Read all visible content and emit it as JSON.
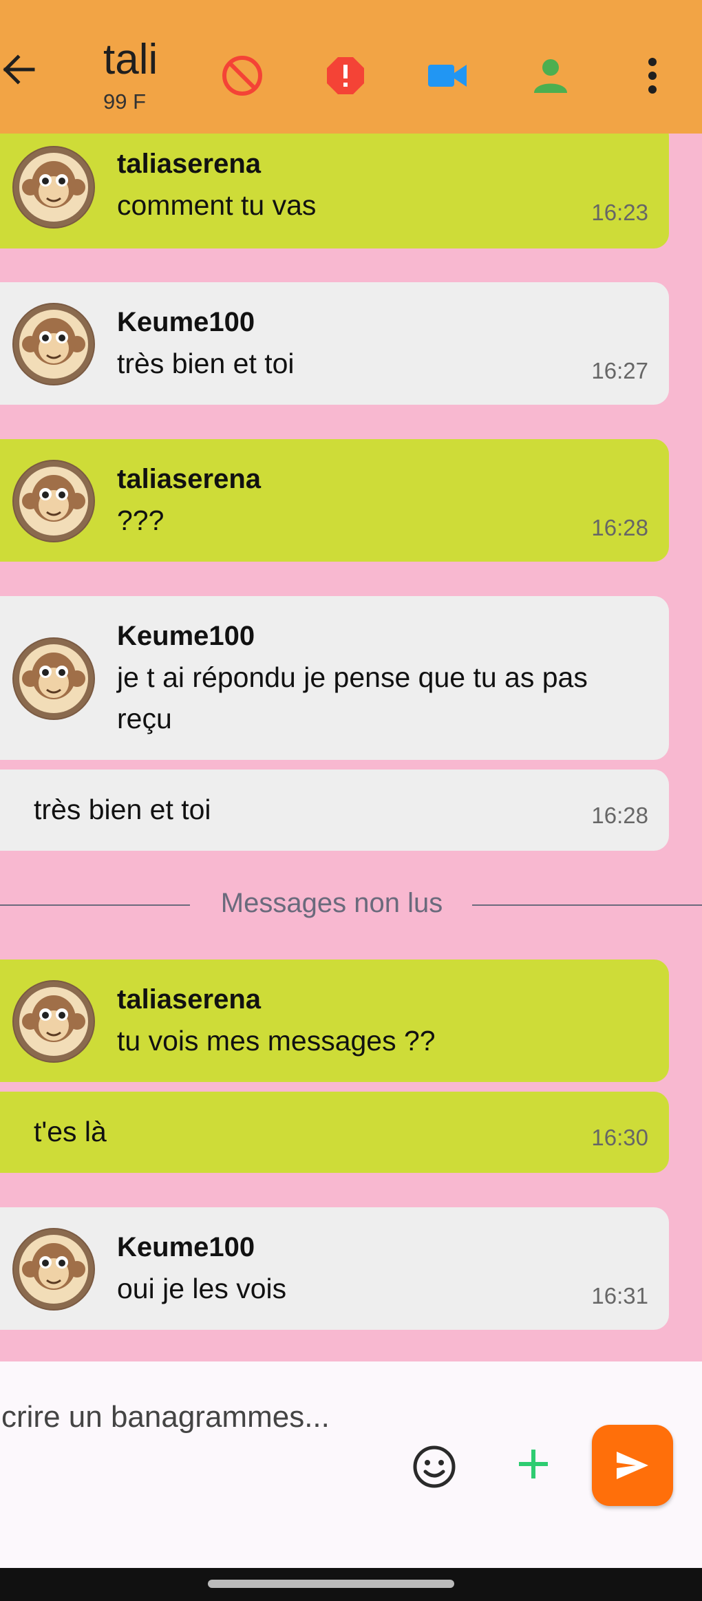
{
  "header": {
    "title": "taliaserena",
    "subtitle": "99 F",
    "colors": {
      "bar": "#f2a445",
      "block": "#f44336",
      "report": "#f44336",
      "video": "#2196f3",
      "profile": "#4caf50"
    },
    "icons": [
      "back-arrow-icon",
      "block-icon",
      "report-icon",
      "video-call-icon",
      "profile-icon",
      "more-vert-icon"
    ]
  },
  "messages": [
    {
      "sender": "taliaserena",
      "text": "comment tu vas",
      "time": "16:23",
      "color": "#cedc38"
    },
    {
      "sender": "Keume100",
      "text": "très bien et toi",
      "time": "16:27",
      "color": "#eeeeee"
    },
    {
      "sender": "taliaserena",
      "text": "???",
      "time": "16:28",
      "color": "#cedc38"
    },
    {
      "sender": "Keume100",
      "text": "je t ai répondu je pense que tu as pas reçu",
      "time": "",
      "color": "#eeeeee"
    },
    {
      "sender": "",
      "text": "très  bien et toi",
      "time": "16:28",
      "color": "#eeeeee"
    },
    {
      "sender": "taliaserena",
      "text": "tu vois mes messages ??",
      "time": "",
      "color": "#cedc38"
    },
    {
      "sender": "",
      "text": "t'es là",
      "time": "16:30",
      "color": "#cedc38"
    },
    {
      "sender": "Keume100",
      "text": "oui je les vois",
      "time": "16:31",
      "color": "#eeeeee"
    }
  ],
  "unread_divider": "Messages non lus",
  "composer": {
    "placeholder": "crire un banagrammes...",
    "icons": [
      "emoji-icon",
      "add-icon",
      "send-icon"
    ],
    "send_color": "#ff6f0a",
    "add_color": "#2ecc71"
  },
  "background_color": "#f8b8d0"
}
